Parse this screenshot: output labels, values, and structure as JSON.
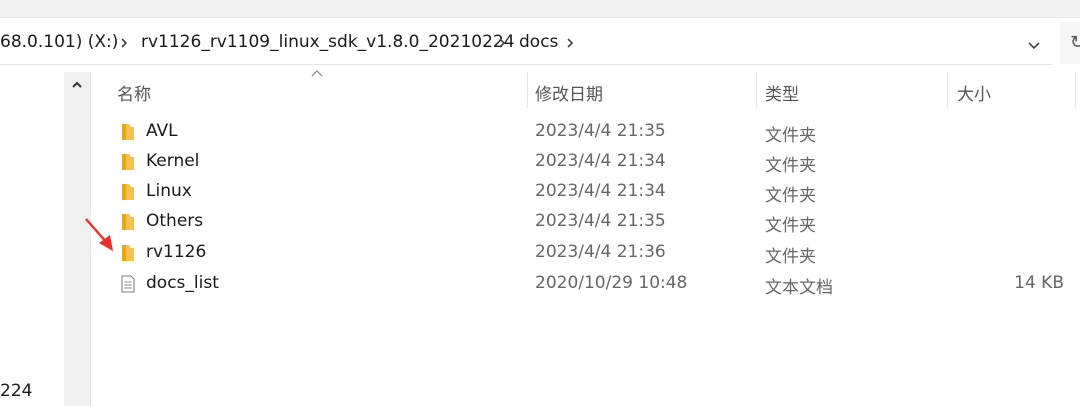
{
  "address": {
    "crumbs": [
      "68.0.101) (X:)",
      "rv1126_rv1109_linux_sdk_v1.8.0_20210224",
      "docs"
    ]
  },
  "left_nav": {
    "partial_text": "224"
  },
  "columns": {
    "name": "名称",
    "date": "修改日期",
    "type": "类型",
    "size": "大小"
  },
  "files": [
    {
      "name": "AVL",
      "date": "2023/4/4 21:35",
      "type": "文件夹",
      "size": "",
      "icon": "folder-icon"
    },
    {
      "name": "Kernel",
      "date": "2023/4/4 21:34",
      "type": "文件夹",
      "size": "",
      "icon": "folder-icon"
    },
    {
      "name": "Linux",
      "date": "2023/4/4 21:34",
      "type": "文件夹",
      "size": "",
      "icon": "folder-icon"
    },
    {
      "name": "Others",
      "date": "2023/4/4 21:35",
      "type": "文件夹",
      "size": "",
      "icon": "folder-icon"
    },
    {
      "name": "rv1126",
      "date": "2023/4/4 21:36",
      "type": "文件夹",
      "size": "",
      "icon": "folder-icon"
    },
    {
      "name": "docs_list",
      "date": "2020/10/29 10:48",
      "type": "文本文档",
      "size": "14 KB",
      "icon": "text-file-icon"
    }
  ],
  "colors": {
    "folder": "#f5c24d",
    "arrow": "#e8312b"
  }
}
